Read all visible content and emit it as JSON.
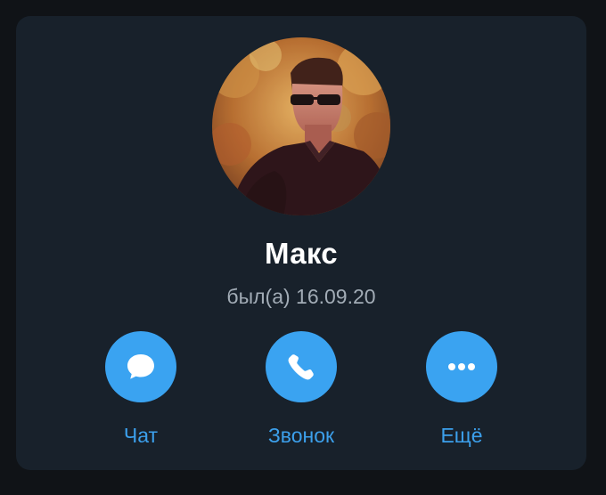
{
  "profile": {
    "name": "Макс",
    "status": "был(а) 16.09.20",
    "avatar_icon": "user-photo"
  },
  "actions": [
    {
      "id": "chat",
      "label": "Чат",
      "icon": "chat-bubble-icon"
    },
    {
      "id": "call",
      "label": "Звонок",
      "icon": "phone-icon"
    },
    {
      "id": "more",
      "label": "Ещё",
      "icon": "more-dots-icon"
    }
  ],
  "colors": {
    "background": "#101317",
    "card": "#18212b",
    "accent": "#3aa3f1",
    "name_text": "#ffffff",
    "status_text": "#a2acb6"
  }
}
